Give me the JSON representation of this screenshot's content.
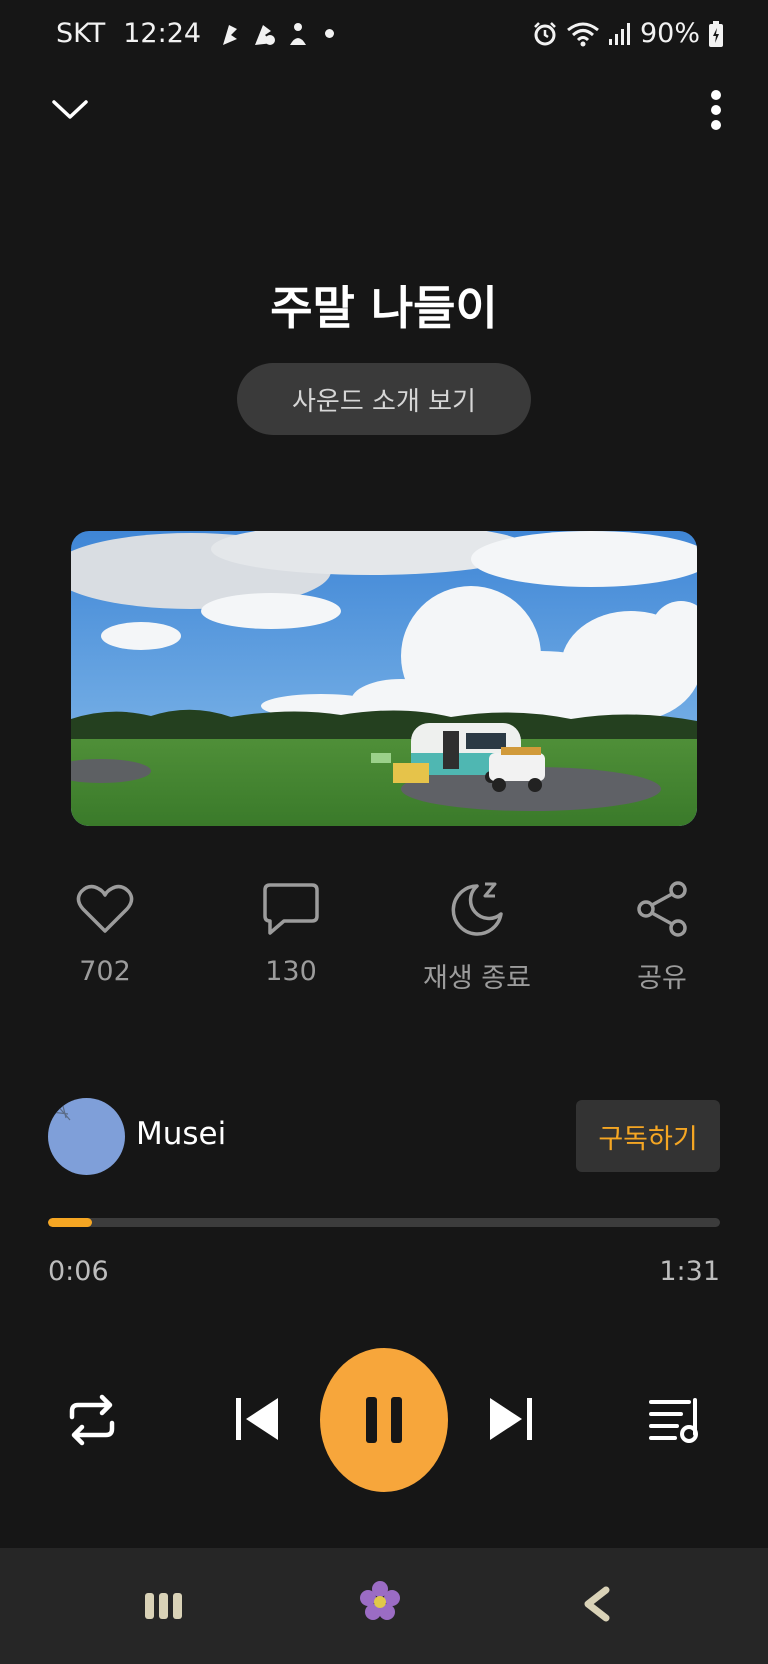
{
  "status_bar": {
    "carrier": "SKT",
    "time": "12:24",
    "battery_percent": "90%",
    "icons": [
      "notification-icon",
      "notification-icon",
      "notification-icon",
      "alarm-icon",
      "wifi-icon",
      "signal-icon",
      "battery-icon"
    ]
  },
  "top_bar": {
    "collapse_icon": "chevron-down-icon",
    "more_icon": "more-vertical-icon"
  },
  "track": {
    "title": "주말 나들이",
    "intro_button": "사운드 소개 보기"
  },
  "actions": [
    {
      "icon": "heart-icon",
      "label": "702"
    },
    {
      "icon": "comment-icon",
      "label": "130"
    },
    {
      "icon": "sleep-timer-icon",
      "label": "재생 종료"
    },
    {
      "icon": "share-icon",
      "label": "공유"
    }
  ],
  "creator": {
    "name": "Musei",
    "subscribe_label": "구독하기"
  },
  "player": {
    "current_time": "0:06",
    "total_time": "1:31",
    "progress_fraction": 0.066,
    "state": "playing"
  },
  "colors": {
    "accent": "#f5a623",
    "background": "#161616",
    "button_bg": "#3a3a3a"
  },
  "nav_bar": {
    "icons": [
      "recent-apps-icon",
      "home-icon",
      "back-icon"
    ]
  }
}
